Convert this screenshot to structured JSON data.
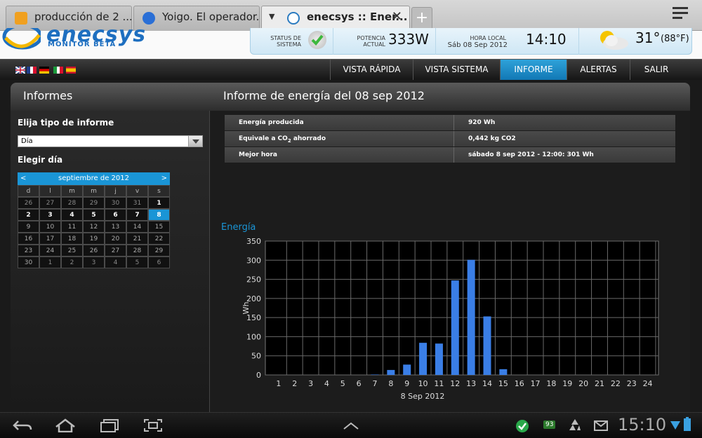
{
  "browser": {
    "tabs": [
      {
        "title": "producción de 2 ...",
        "active": false,
        "favicon": "yellow-shield-icon"
      },
      {
        "title": "Yoigo. El operador...",
        "active": false,
        "favicon": "yoigo-icon"
      },
      {
        "title": "enecsys :: Ener...",
        "active": true,
        "favicon": "enecsys-icon"
      }
    ],
    "close_glyph": "✕",
    "newtab_glyph": "+"
  },
  "header": {
    "logo_text": "enecsys",
    "logo_sub": "MONITOR BETA",
    "status_label_1": "STATUS DE",
    "status_label_2": "SISTEMA",
    "power_label_1": "POTENCIA",
    "power_label_2": "ACTUAL",
    "power_value": "333W",
    "time_label": "HORA LOCAL",
    "date_value": "Sáb 08 Sep 2012",
    "time_value": "14:10",
    "temp_c": "31°",
    "temp_f": "(88°F)"
  },
  "nav": {
    "items": [
      "VISTA RÁPIDA",
      "VISTA SISTEMA",
      "INFORME",
      "ALERTAS",
      "SALIR"
    ],
    "active_index": 2
  },
  "content": {
    "left_title": "Informes",
    "right_title": "Informe de energía del 08 sep 2012",
    "report_type_label": "Elija tipo de informe",
    "report_type_value": "Día",
    "day_label": "Elegir día",
    "calendar": {
      "month": "septiembre de 2012",
      "prev": "<",
      "next": ">",
      "dow": [
        "d",
        "l",
        "m",
        "m",
        "j",
        "v",
        "s"
      ],
      "weeks": [
        [
          "26",
          "27",
          "28",
          "29",
          "30",
          "31",
          "1"
        ],
        [
          "2",
          "3",
          "4",
          "5",
          "6",
          "7",
          "8"
        ],
        [
          "9",
          "10",
          "11",
          "12",
          "13",
          "14",
          "15"
        ],
        [
          "16",
          "17",
          "18",
          "19",
          "20",
          "21",
          "22"
        ],
        [
          "23",
          "24",
          "25",
          "26",
          "27",
          "28",
          "29"
        ],
        [
          "30",
          "1",
          "2",
          "3",
          "4",
          "5",
          "6"
        ]
      ],
      "selected": "8"
    },
    "info": [
      {
        "label": "Energía producida",
        "value": "920 Wh"
      },
      {
        "label_pre": "Equivale a CO",
        "label_sub": "2",
        "label_post": " ahorrado",
        "value": "0,442 kg CO2"
      },
      {
        "label": "Mejor hora",
        "value": "sábado 8 sep 2012 - 12:00: 301 Wh"
      }
    ],
    "energy_title": "Energía"
  },
  "chart_data": {
    "type": "bar",
    "categories": [
      "1",
      "2",
      "3",
      "4",
      "5",
      "6",
      "7",
      "8",
      "9",
      "10",
      "11",
      "12",
      "13",
      "14",
      "15",
      "16",
      "17",
      "18",
      "19",
      "20",
      "21",
      "22",
      "23",
      "24"
    ],
    "values": [
      0,
      0,
      0,
      0,
      0,
      0,
      1,
      13,
      27,
      84,
      82,
      247,
      301,
      153,
      15,
      0,
      0,
      0,
      0,
      0,
      0,
      0,
      0,
      0
    ],
    "xlabel": "8 Sep 2012",
    "ylabel": "Wh",
    "ylim": [
      0,
      350
    ],
    "yticks": [
      0,
      50,
      100,
      150,
      200,
      250,
      300,
      350
    ],
    "bar_color": "#3a7ee6",
    "grid": true
  },
  "system": {
    "clock": "15:10",
    "battery_badge": "93"
  }
}
